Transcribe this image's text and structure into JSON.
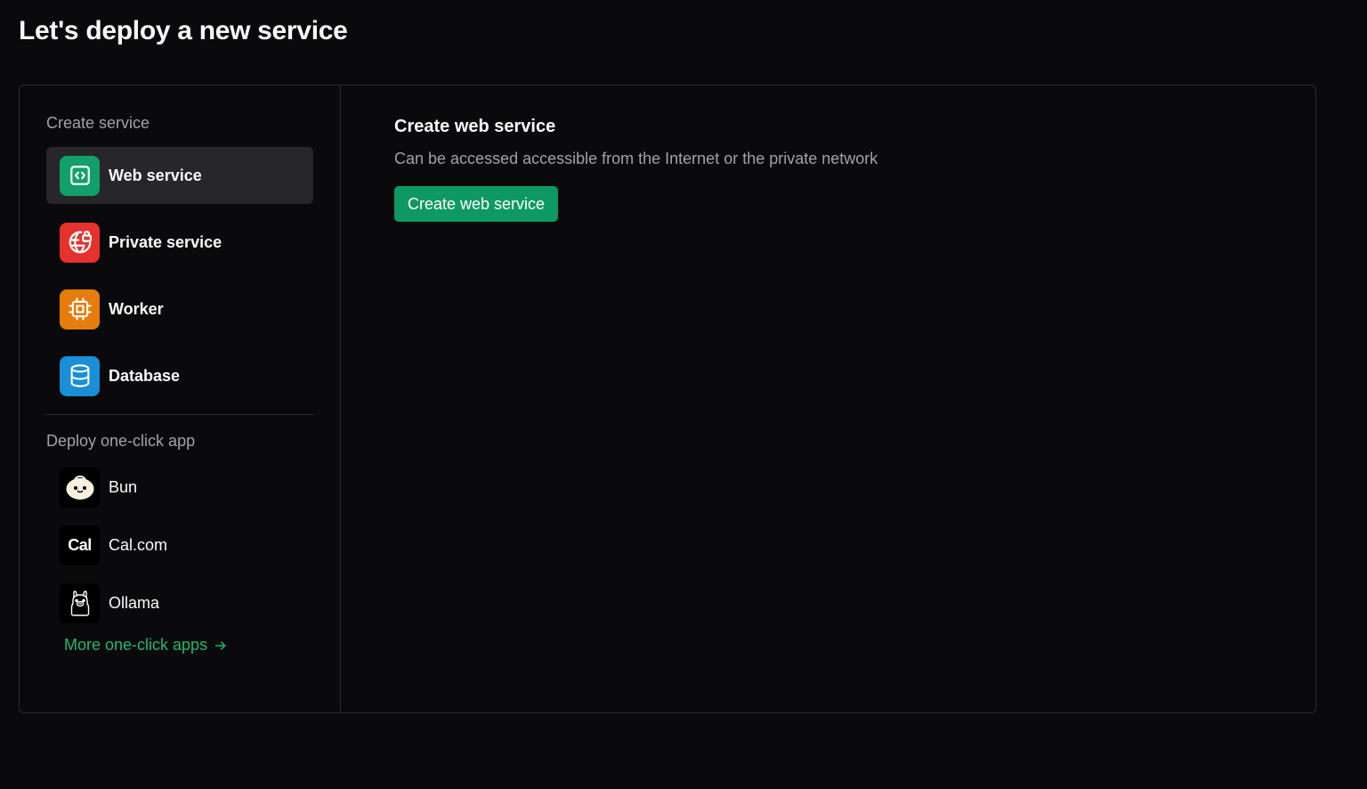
{
  "page": {
    "title": "Let's deploy a new service"
  },
  "sidebar": {
    "create_heading": "Create service",
    "services": [
      {
        "label": "Web service",
        "icon": "code-window-icon",
        "color": "#12a06a",
        "active": true
      },
      {
        "label": "Private service",
        "icon": "globe-lock-icon",
        "color": "#e5322d"
      },
      {
        "label": "Worker",
        "icon": "cpu-chip-icon",
        "color": "#e57c0b"
      },
      {
        "label": "Database",
        "icon": "database-icon",
        "color": "#1a8ed6"
      }
    ],
    "deploy_heading": "Deploy one-click app",
    "apps": [
      {
        "label": "Bun",
        "icon": "bun-logo-icon"
      },
      {
        "label": "Cal.com",
        "icon": "cal-logo-icon",
        "logo_text": "Cal"
      },
      {
        "label": "Ollama",
        "icon": "ollama-logo-icon"
      }
    ],
    "more_link": "More one-click apps"
  },
  "content": {
    "title": "Create web service",
    "description": "Can be accessed accessible from the Internet or the private network",
    "button_label": "Create web service"
  }
}
